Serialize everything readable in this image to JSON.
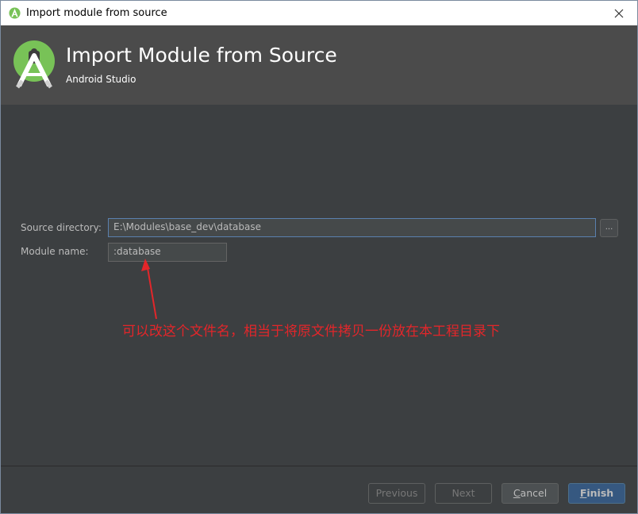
{
  "window": {
    "title": "Import module from source",
    "close_glyph": "✕"
  },
  "header": {
    "title": "Import Module from Source",
    "subtitle": "Android Studio",
    "logo_icon": "android-studio-logo-icon"
  },
  "form": {
    "source_directory_label": "Source directory:",
    "source_directory_value": "E:\\Modules\\base_dev\\database",
    "browse_label": "...",
    "module_name_label": "Module name:",
    "module_name_value": ":database"
  },
  "annotation": {
    "text": "可以改这个文件名，相当于将原文件拷贝一份放在本工程目录下",
    "color": "#e3262a"
  },
  "footer": {
    "previous": "Previous",
    "next": "Next",
    "cancel_first": "C",
    "cancel_rest": "ancel",
    "finish_first": "F",
    "finish_rest": "inish"
  },
  "colors": {
    "dialog_bg": "#3c3f41",
    "header_bg": "#4b4b4b",
    "primary_button": "#365880",
    "logo_green": "#78c257"
  }
}
